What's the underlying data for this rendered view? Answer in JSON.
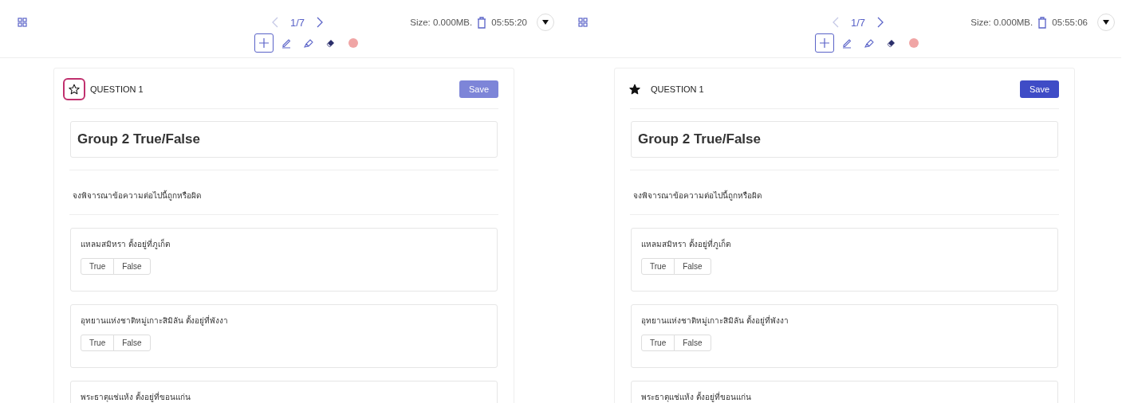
{
  "panels": [
    {
      "toolbar": {
        "page": "1/7",
        "size": "Size: 0.000MB.",
        "time": "05:55:20",
        "tools": [
          {
            "kind": "move",
            "selected": true
          },
          {
            "kind": "pen",
            "selected": false
          },
          {
            "kind": "highlighter",
            "selected": false
          },
          {
            "kind": "eraser",
            "selected": false
          },
          {
            "kind": "color",
            "selected": false
          }
        ]
      },
      "question": {
        "label": "QUESTION 1",
        "starred": false,
        "star_focused": true,
        "save": {
          "label": "Save",
          "disabled": true
        },
        "title": "Group 2 True/False",
        "instruction": "จงพิจารณาข้อความต่อไปนี้ถูกหรือผิด",
        "items": [
          {
            "text": "แหลมสมิหรา ตั้งอยู่ที่ภูเก็ต",
            "options": [
              "True",
              "False"
            ]
          },
          {
            "text": "อุทยานแห่งชาติหมู่เกาะสิมิลัน ตั้งอยู่ที่พังงา",
            "options": [
              "True",
              "False"
            ]
          },
          {
            "text": "พระธาตุแช่แห้ง ตั้งอยู่ที่ขอนแก่น"
          }
        ]
      }
    },
    {
      "toolbar": {
        "page": "1/7",
        "size": "Size: 0.000MB.",
        "time": "05:55:06",
        "tools": [
          {
            "kind": "move",
            "selected": true
          },
          {
            "kind": "pen",
            "selected": false
          },
          {
            "kind": "highlighter",
            "selected": false
          },
          {
            "kind": "eraser",
            "selected": false
          },
          {
            "kind": "color",
            "selected": false
          }
        ]
      },
      "question": {
        "label": "QUESTION 1",
        "starred": true,
        "star_focused": false,
        "save": {
          "label": "Save",
          "disabled": false
        },
        "title": "Group 2 True/False",
        "instruction": "จงพิจารณาข้อความต่อไปนี้ถูกหรือผิด",
        "items": [
          {
            "text": "แหลมสมิหรา ตั้งอยู่ที่ภูเก็ต",
            "options": [
              "True",
              "False"
            ]
          },
          {
            "text": "อุทยานแห่งชาติหมู่เกาะสิมิลัน ตั้งอยู่ที่พังงา",
            "options": [
              "True",
              "False"
            ]
          },
          {
            "text": "พระธาตุแช่แห้ง ตั้งอยู่ที่ขอนแก่น"
          }
        ]
      }
    }
  ]
}
